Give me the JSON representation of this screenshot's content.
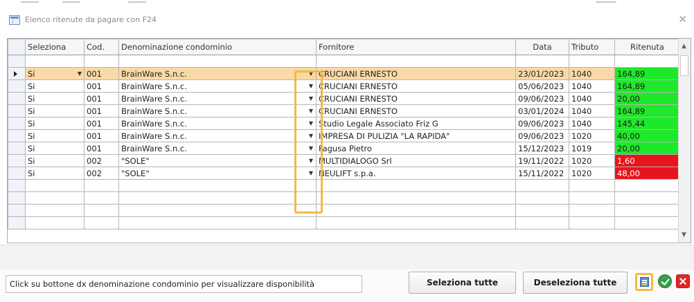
{
  "window": {
    "title": "Elenco ritenute da pagare con F24",
    "close_glyph": "✕"
  },
  "columns": {
    "seleziona": "Seleziona",
    "cod": "Cod.",
    "denominazione": "Denominazione condominio",
    "fornitore": "Fornitore",
    "data": "Data",
    "tributo": "Tributo",
    "ritenuta": "Ritenuta"
  },
  "rows": [
    {
      "sel": "Si",
      "cod": "001",
      "denom": "BrainWare S.n.c.",
      "fornitore": "CRUCIANI ERNESTO",
      "data": "23/01/2023",
      "tributo": "1040",
      "ritenuta": "164,89",
      "status": "green"
    },
    {
      "sel": "Si",
      "cod": "001",
      "denom": "BrainWare S.n.c.",
      "fornitore": "CRUCIANI ERNESTO",
      "data": "05/06/2023",
      "tributo": "1040",
      "ritenuta": "164,89",
      "status": "green"
    },
    {
      "sel": "Si",
      "cod": "001",
      "denom": "BrainWare S.n.c.",
      "fornitore": "CRUCIANI ERNESTO",
      "data": "09/06/2023",
      "tributo": "1040",
      "ritenuta": "20,00",
      "status": "green"
    },
    {
      "sel": "Si",
      "cod": "001",
      "denom": "BrainWare S.n.c.",
      "fornitore": "CRUCIANI ERNESTO",
      "data": "03/01/2024",
      "tributo": "1040",
      "ritenuta": "164,89",
      "status": "green"
    },
    {
      "sel": "Si",
      "cod": "001",
      "denom": "BrainWare S.n.c.",
      "fornitore": "Studio Legale Associato Friz G",
      "data": "09/06/2023",
      "tributo": "1040",
      "ritenuta": "145,44",
      "status": "green"
    },
    {
      "sel": "Si",
      "cod": "001",
      "denom": "BrainWare S.n.c.",
      "fornitore": "IMPRESA DI PULIZIA \"LA RAPIDA\"",
      "data": "09/06/2023",
      "tributo": "1020",
      "ritenuta": "40,00",
      "status": "green"
    },
    {
      "sel": "Si",
      "cod": "001",
      "denom": "BrainWare S.n.c.",
      "fornitore": "Fagusa Pietro",
      "data": "15/12/2023",
      "tributo": "1019",
      "ritenuta": "20,00",
      "status": "green"
    },
    {
      "sel": "Si",
      "cod": "002",
      "denom": "\"SOLE\"",
      "fornitore": "MULTIDIALOGO Srl",
      "data": "19/11/2022",
      "tributo": "1020",
      "ritenuta": "1,60",
      "status": "red"
    },
    {
      "sel": "Si",
      "cod": "002",
      "denom": "\"SOLE\"",
      "fornitore": "NEULIFT s.p.a.",
      "data": "15/11/2022",
      "tributo": "1020",
      "ritenuta": "48,00",
      "status": "red"
    }
  ],
  "footer": {
    "hint": "Click su bottone dx denominazione condominio per visualizzare disponibilità",
    "select_all": "Seleziona tutte",
    "deselect_all": "Deseleziona tutte"
  },
  "colors": {
    "green": "#1ee82a",
    "red": "#e8141c",
    "selected_row": "#f9d9a6",
    "highlight": "#f4b942"
  }
}
